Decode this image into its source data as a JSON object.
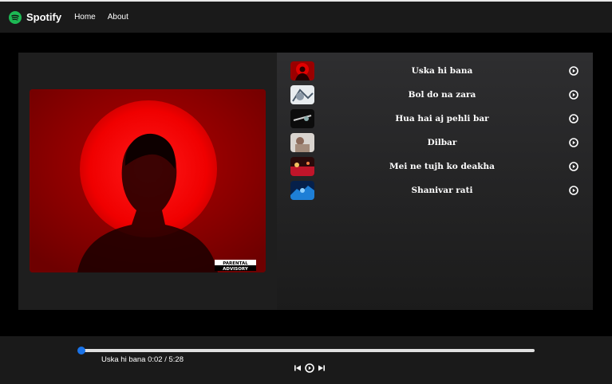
{
  "navbar": {
    "brand": "Spotify",
    "links": [
      "Home",
      "About"
    ]
  },
  "cover": {
    "badge_line1": "PARENTAL",
    "badge_line2": "ADVISORY"
  },
  "songs": [
    {
      "name": "Uska hi bana"
    },
    {
      "name": "Bol do na zara"
    },
    {
      "name": "Hua hai aj pehli bar"
    },
    {
      "name": "Dilbar"
    },
    {
      "name": "Mei ne tujh ko deakha"
    },
    {
      "name": "Shanivar rati"
    }
  ],
  "player": {
    "now_playing": "Uska hi bana 0:02 / 5:28",
    "progress": 0.006
  },
  "colors": {
    "brand": "#1db954",
    "accent": "#1a73e8"
  }
}
